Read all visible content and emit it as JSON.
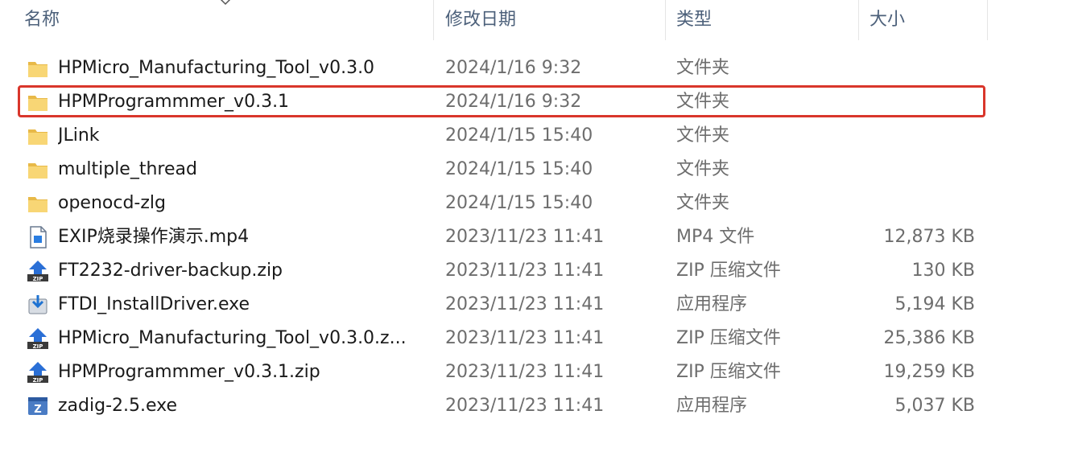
{
  "columns": {
    "name": "名称",
    "date": "修改日期",
    "type": "类型",
    "size": "大小"
  },
  "files": [
    {
      "name": "HPMicro_Manufacturing_Tool_v0.3.0",
      "date": "2024/1/16 9:32",
      "type": "文件夹",
      "size": "",
      "icon": "folder-icon"
    },
    {
      "name": "HPMProgrammmer_v0.3.1",
      "date": "2024/1/16 9:32",
      "type": "文件夹",
      "size": "",
      "icon": "folder-icon",
      "highlighted": true
    },
    {
      "name": "JLink",
      "date": "2024/1/15 15:40",
      "type": "文件夹",
      "size": "",
      "icon": "folder-icon"
    },
    {
      "name": "multiple_thread",
      "date": "2024/1/15 15:40",
      "type": "文件夹",
      "size": "",
      "icon": "folder-icon"
    },
    {
      "name": "openocd-zlg",
      "date": "2024/1/15 15:40",
      "type": "文件夹",
      "size": "",
      "icon": "folder-icon"
    },
    {
      "name": "EXIP烧录操作演示.mp4",
      "date": "2023/11/23 11:41",
      "type": "MP4 文件",
      "size": "12,873 KB",
      "icon": "video-file-icon"
    },
    {
      "name": "FT2232-driver-backup.zip",
      "date": "2023/11/23 11:41",
      "type": "ZIP 压缩文件",
      "size": "130 KB",
      "icon": "zip-file-icon"
    },
    {
      "name": "FTDI_InstallDriver.exe",
      "date": "2023/11/23 11:41",
      "type": "应用程序",
      "size": "5,194 KB",
      "icon": "installer-icon"
    },
    {
      "name": "HPMicro_Manufacturing_Tool_v0.3.0.z...",
      "date": "2023/11/23 11:41",
      "type": "ZIP 压缩文件",
      "size": "25,386 KB",
      "icon": "zip-file-icon"
    },
    {
      "name": "HPMProgrammmer_v0.3.1.zip",
      "date": "2023/11/23 11:41",
      "type": "ZIP 压缩文件",
      "size": "19,259 KB",
      "icon": "zip-file-icon"
    },
    {
      "name": "zadig-2.5.exe",
      "date": "2023/11/23 11:41",
      "type": "应用程序",
      "size": "5,037 KB",
      "icon": "app-exe-icon"
    }
  ],
  "colors": {
    "highlight": "#d9362b",
    "folder": "#f8d675",
    "header_text": "#4c607a"
  }
}
